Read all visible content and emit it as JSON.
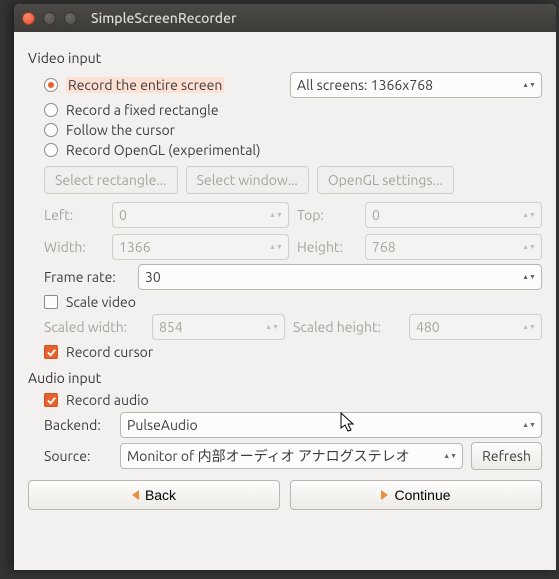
{
  "window": {
    "title": "SimpleScreenRecorder"
  },
  "video": {
    "section": "Video input",
    "radios": {
      "entire": "Record the entire screen",
      "fixed": "Record a fixed rectangle",
      "cursor": "Follow the cursor",
      "opengl": "Record OpenGL (experimental)"
    },
    "screens_combo": "All screens: 1366x768",
    "buttons": {
      "select_rect": "Select rectangle...",
      "select_win": "Select window...",
      "opengl_settings": "OpenGL settings..."
    },
    "labels": {
      "left": "Left:",
      "top": "Top:",
      "width": "Width:",
      "height": "Height:",
      "frame_rate": "Frame rate:",
      "scale": "Scale video",
      "scaled_w": "Scaled width:",
      "scaled_h": "Scaled height:",
      "record_cursor": "Record cursor"
    },
    "values": {
      "left": "0",
      "top": "0",
      "width": "1366",
      "height": "768",
      "frame_rate": "30",
      "scaled_w": "854",
      "scaled_h": "480"
    }
  },
  "audio": {
    "section": "Audio input",
    "record": "Record audio",
    "backend_label": "Backend:",
    "backend_value": "PulseAudio",
    "source_label": "Source:",
    "source_value": "Monitor of 内部オーディオ アナログステレオ",
    "refresh": "Refresh"
  },
  "footer": {
    "back": "Back",
    "continue": "Continue"
  }
}
